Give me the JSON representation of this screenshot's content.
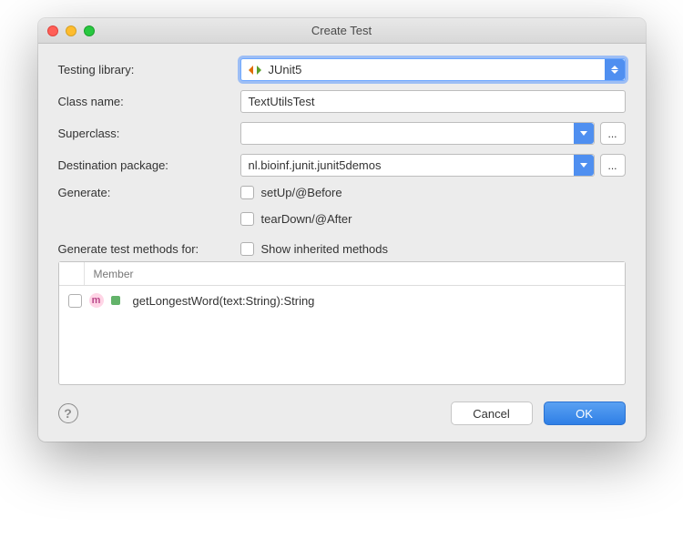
{
  "window": {
    "title": "Create Test"
  },
  "labels": {
    "testing_library": "Testing library:",
    "class_name": "Class name:",
    "superclass": "Superclass:",
    "destination_package": "Destination package:",
    "generate": "Generate:",
    "generate_methods_for": "Generate test methods for:"
  },
  "fields": {
    "testing_library": "JUnit5",
    "class_name": "TextUtilsTest",
    "superclass": "",
    "destination_package": "nl.bioinf.junit.junit5demos"
  },
  "generate": {
    "setup": "setUp/@Before",
    "teardown": "tearDown/@After"
  },
  "methods": {
    "show_inherited": "Show inherited methods",
    "header": "Member",
    "items": [
      {
        "signature": "getLongestWord(text:String):String"
      }
    ]
  },
  "buttons": {
    "more": "...",
    "cancel": "Cancel",
    "ok": "OK"
  }
}
